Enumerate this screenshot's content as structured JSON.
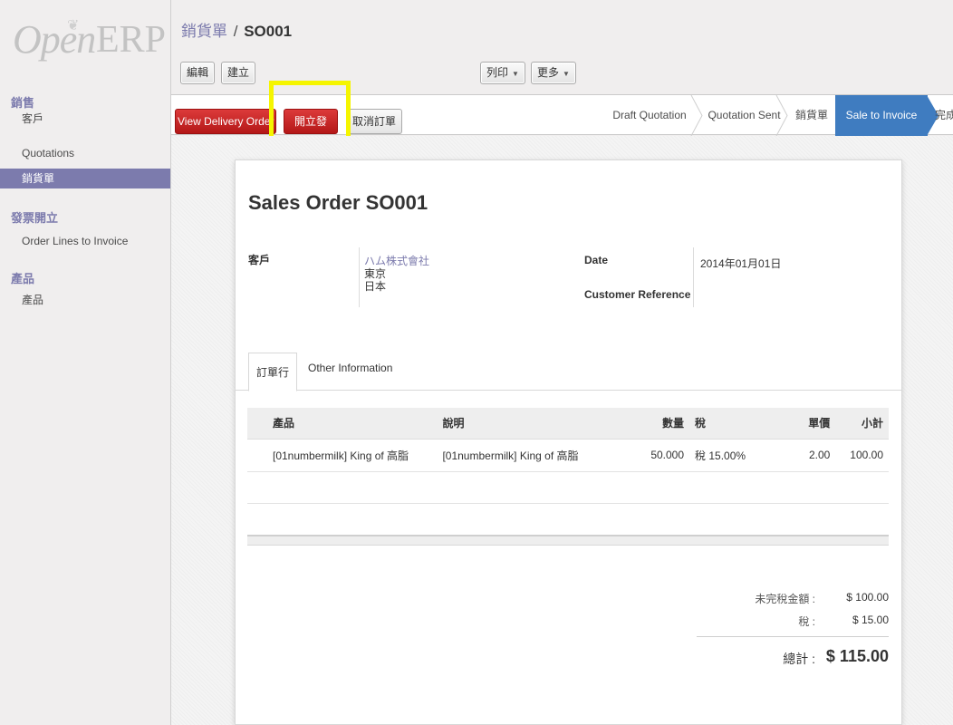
{
  "app": {
    "logo_open": "Open",
    "logo_erp": "ERP"
  },
  "sidebar": {
    "sections": [
      {
        "title": "銷售",
        "items": [
          {
            "label": "客戶"
          },
          {
            "label": "Quotations"
          },
          {
            "label": "銷貨單"
          }
        ]
      },
      {
        "title": "發票開立",
        "items": [
          {
            "label": "Order Lines to Invoice"
          }
        ]
      },
      {
        "title": "產品",
        "items": [
          {
            "label": "產品"
          }
        ]
      }
    ]
  },
  "header": {
    "breadcrumb_parent": "銷貨單",
    "breadcrumb_sep": "/",
    "breadcrumb_current": "SO001",
    "buttons": {
      "edit": "編輯",
      "create": "建立",
      "print": "列印",
      "more": "更多"
    }
  },
  "actions": {
    "view_delivery": "View Delivery Order",
    "create_invoice": "開立發票",
    "cancel_order": "取消訂單"
  },
  "statusbar": {
    "stages": [
      "Draft Quotation",
      "Quotation Sent",
      "銷貨單",
      "Sale to Invoice",
      "完成"
    ],
    "active": "Sale to Invoice"
  },
  "document": {
    "title_prefix": "Sales Order",
    "title_number": "SO001",
    "customer_label": "客戶",
    "customer_name": "ハム株式會社",
    "customer_city": "東京",
    "customer_country": "日本",
    "date_label": "Date",
    "date_value": "2014年01月01日",
    "customer_ref_label": "Customer Reference",
    "customer_ref_value": ""
  },
  "tabs": {
    "order_lines": "訂單行",
    "other_info": "Other Information"
  },
  "lines_table": {
    "headers": [
      "產品",
      "說明",
      "數量",
      "稅",
      "單價",
      "小計"
    ],
    "rows": [
      [
        "[01numbermilk] King of 高脂",
        "[01numbermilk] King of 高脂",
        "50.000",
        "稅 15.00%",
        "2.00",
        "100.00"
      ]
    ]
  },
  "totals": {
    "untaxed_label": "未完稅金額 :",
    "untaxed_value": "$ 100.00",
    "tax_label": "稅 :",
    "tax_value": "$ 15.00",
    "total_label": "總計 :",
    "total_value": "$ 115.00"
  },
  "colors": {
    "accent": "#7c7bad",
    "danger": "#c02424",
    "stage_active": "#3f7cc0",
    "highlight": "#f5f500"
  }
}
